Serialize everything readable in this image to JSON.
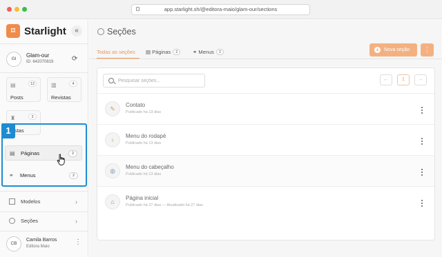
{
  "browser": {
    "url": "app.starlight.sh/@editora-maio/glam-our/sections"
  },
  "sidebar": {
    "brand": "Starlight",
    "logo_glyph": "⌑",
    "collapse_glyph": "«",
    "workspace": {
      "initials": "Gl",
      "name": "Glam-our",
      "id": "ID: 642070819"
    },
    "cards": [
      {
        "label": "Posts",
        "count": "12",
        "icon": "document-icon"
      },
      {
        "label": "Revistas",
        "count": "4",
        "icon": "magazine-icon"
      },
      {
        "label": "Listas",
        "count": "3",
        "icon": "list-icon"
      }
    ],
    "highlight_number": "1",
    "nav": [
      {
        "label": "Páginas",
        "count": "2",
        "icon": "page-icon"
      },
      {
        "label": "Menus",
        "count": "2",
        "icon": "link-icon"
      }
    ],
    "sections": [
      {
        "label": "Modelos",
        "icon": "square-icon"
      },
      {
        "label": "Seções",
        "icon": "circle-icon"
      }
    ],
    "user": {
      "initials": "CB",
      "name": "Camila Barros",
      "role": "Editora Maio"
    }
  },
  "main": {
    "title": "Seções",
    "tabs": [
      {
        "label": "Todas as seções",
        "count": ""
      },
      {
        "label": "Páginas",
        "count": "2"
      },
      {
        "label": "Menus",
        "count": "2"
      }
    ],
    "new_button": "Nova seção",
    "search_placeholder": "Pesquisar seções...",
    "pagination": {
      "prev": "←",
      "page": "1",
      "next": "→"
    },
    "rows": [
      {
        "title": "Contato",
        "subtitle": "Publicado há 13 dias",
        "icon": "pencil-icon"
      },
      {
        "title": "Menu do rodapé",
        "subtitle": "Publicado há 13 dias",
        "icon": "ice-cream-icon"
      },
      {
        "title": "Menu do cabeçalho",
        "subtitle": "Publicado há 13 dias",
        "icon": "globe-icon"
      },
      {
        "title": "Página inicial",
        "subtitle": "Publicado há 27 dias — Atualizado há 27 dias",
        "icon": "house-icon"
      }
    ]
  },
  "colors": {
    "accent": "#f0944f",
    "highlight": "#1e8bd1"
  }
}
